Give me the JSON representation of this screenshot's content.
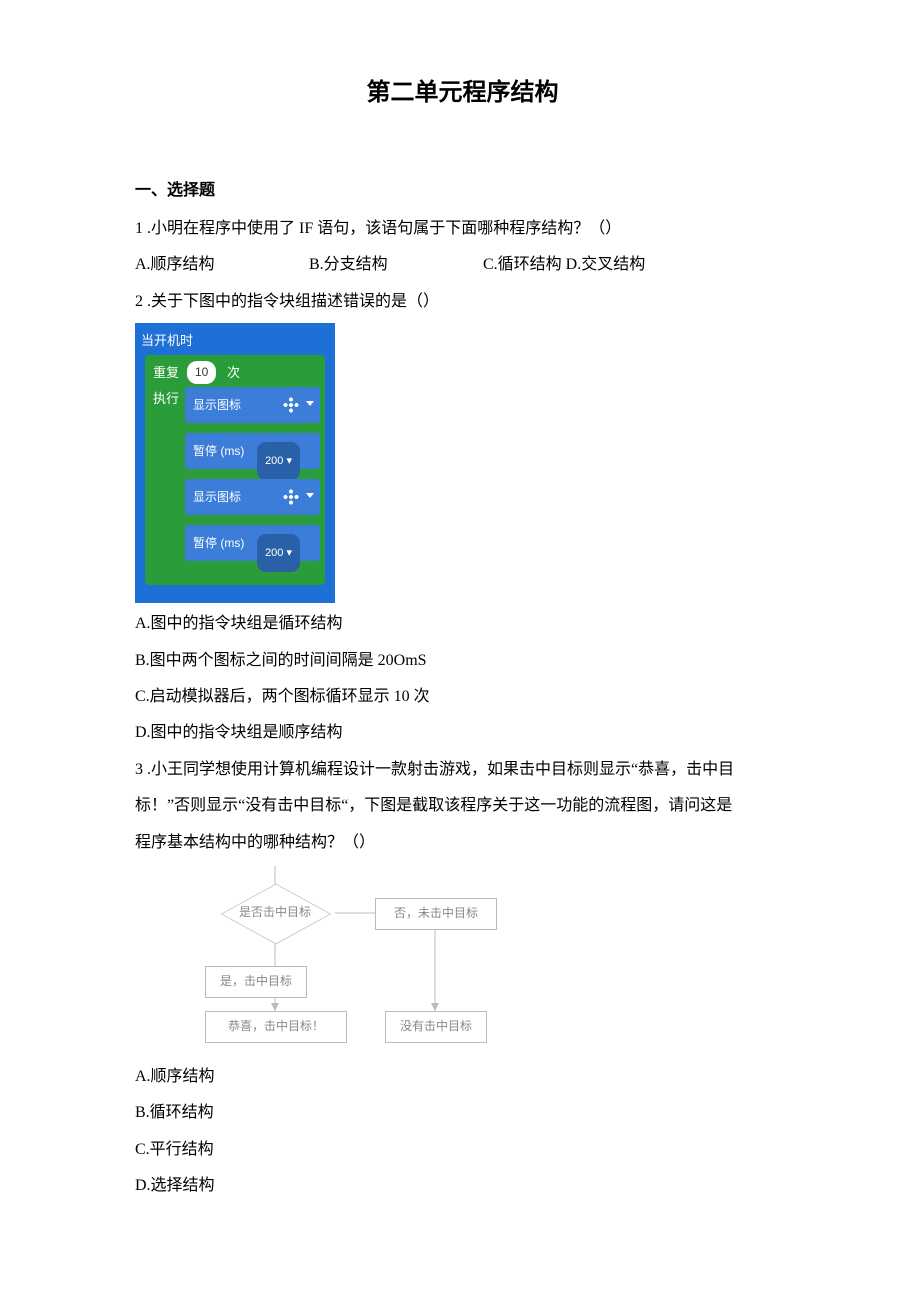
{
  "title": "第二单元程序结构",
  "section1": "一、选择题",
  "q1": {
    "text": "1 .小明在程序中使用了 IF 语句，该语句属于下面哪种程序结构？（）",
    "optA": "A.顺序结构",
    "optB": "B.分支结构",
    "optCD": "C.循环结构 D.交叉结构"
  },
  "q2": {
    "text": "2  .关于下图中的指令块组描述错误的是（）",
    "blk": {
      "start": "当开机时",
      "repeat": "重复",
      "count": "10",
      "ci": "次",
      "exec": "执行",
      "showIcon": "显示图标",
      "pause": "暂停 (ms)",
      "ms": "200 ▾"
    },
    "optA": "A.图中的指令块组是循环结构",
    "optB": "B.图中两个图标之间的时间间隔是 20OmS",
    "optC": "C.启动模拟器后，两个图标循环显示 10 次",
    "optD": "D.图中的指令块组是顺序结构"
  },
  "q3": {
    "l1": "3  .小王同学想使用计算机编程设计一款射击游戏，如果击中目标则显示“恭喜，击中目",
    "l2": "标！”否则显示“没有击中目标“，下图是截取该程序关于这一功能的流程图，请问这是",
    "l3": "程序基本结构中的哪种结构？（）",
    "flow": {
      "cond": "是否击中目标",
      "noLabel": "否，未击中目标",
      "yesLabel": "是，击中目标",
      "yesBox": "恭喜，击中目标！",
      "noBox": "没有击中目标"
    },
    "optA": "A.顺序结构",
    "optB": "B.循环结构",
    "optC": "C.平行结构",
    "optD": "D.选择结构"
  }
}
